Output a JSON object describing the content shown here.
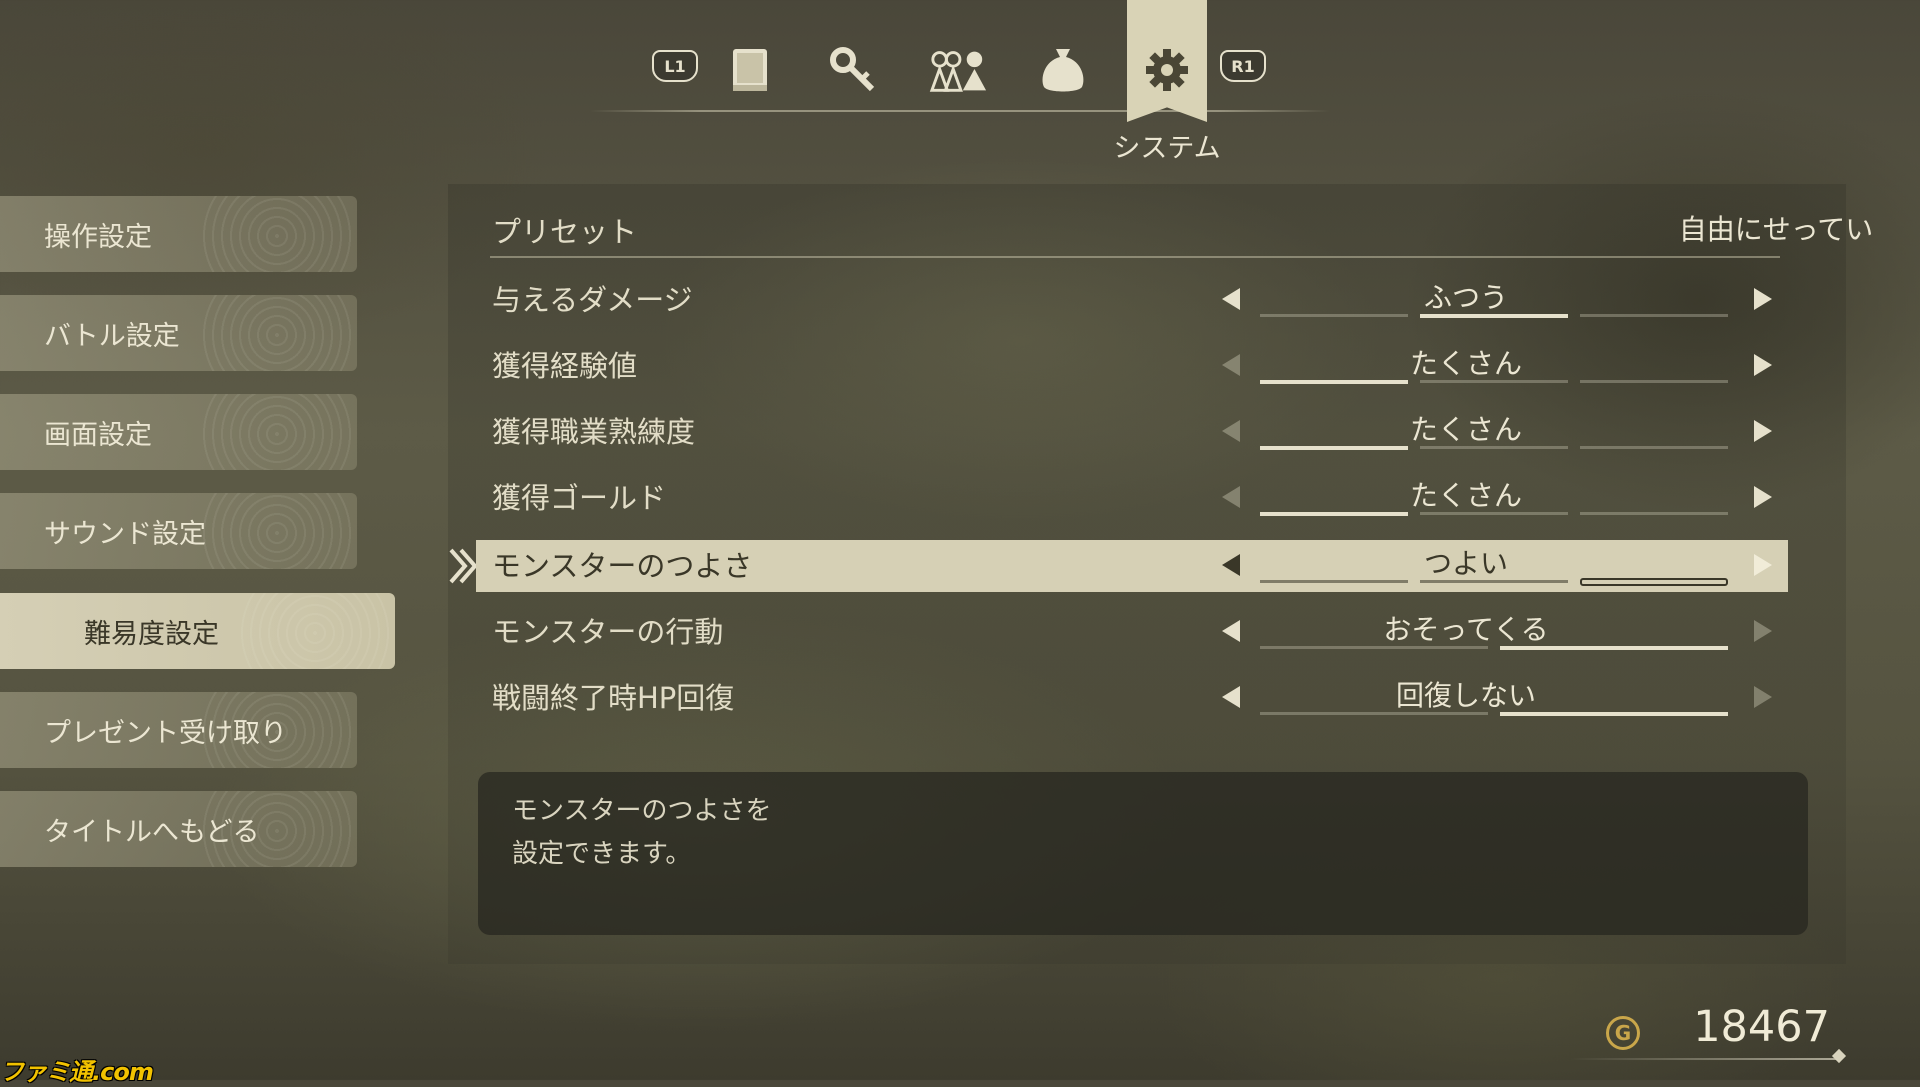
{
  "tabs": {
    "prev_button": "L1",
    "next_button": "R1",
    "icons": [
      "book-icon",
      "key-icon",
      "party-icon",
      "bag-icon",
      "gear-icon"
    ],
    "active_index": 4,
    "active_label": "システム"
  },
  "sidebar": {
    "items": [
      {
        "label": "操作設定"
      },
      {
        "label": "バトル設定"
      },
      {
        "label": "画面設定"
      },
      {
        "label": "サウンド設定"
      },
      {
        "label": "難易度設定",
        "active": true
      },
      {
        "label": "プレゼント受け取り"
      },
      {
        "label": "タイトルへもどる"
      }
    ]
  },
  "settings": {
    "preset": {
      "label": "プリセット",
      "value": "自由にせってい"
    },
    "rows": [
      {
        "label": "与えるダメージ",
        "value": "ふつう",
        "level": 2,
        "levels": 3
      },
      {
        "label": "獲得経験値",
        "value": "たくさん",
        "level": 1,
        "levels": 3
      },
      {
        "label": "獲得職業熟練度",
        "value": "たくさん",
        "level": 1,
        "levels": 3
      },
      {
        "label": "獲得ゴールド",
        "value": "たくさん",
        "level": 1,
        "levels": 3
      },
      {
        "label": "モンスターのつよさ",
        "value": "つよい",
        "level": 3,
        "levels": 3,
        "selected": true
      },
      {
        "label": "モンスターの行動",
        "value": "おそってくる",
        "level": 2,
        "levels": 2
      },
      {
        "label": "戦闘終了時HP回復",
        "value": "回復しない",
        "level": 2,
        "levels": 2
      }
    ]
  },
  "description": {
    "line1": "モンスターのつよさを",
    "line2": "設定できます。"
  },
  "gold": {
    "icon_glyph": "G",
    "value": "18467"
  },
  "watermark": {
    "text": "ファミ通.com"
  },
  "colors": {
    "accent": "#d6d0b5",
    "text": "#ebe6d2",
    "gold": "#c9a64a",
    "watermark": "#f2c200"
  }
}
